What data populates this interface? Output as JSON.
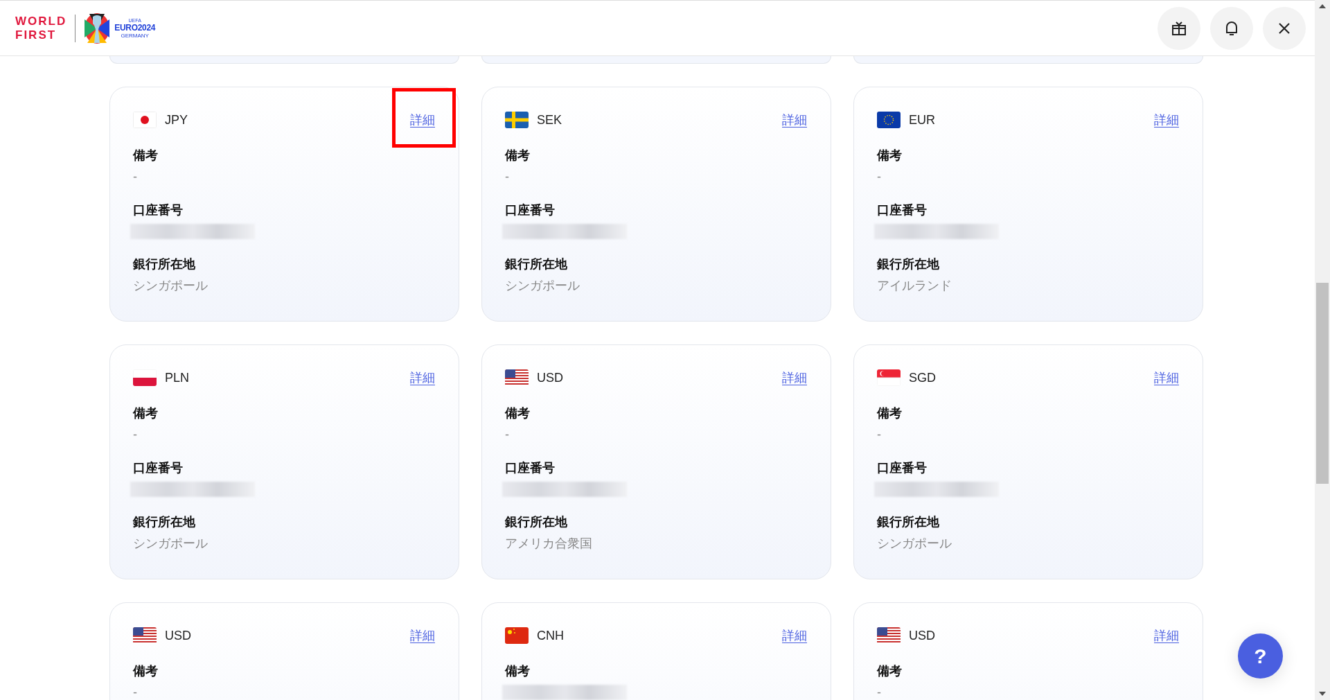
{
  "header": {
    "brand_lines": [
      "WORLD",
      "FIRST"
    ],
    "euro_logo": {
      "top": "UEFA",
      "main": "EURO2024",
      "sub": "GERMANY"
    }
  },
  "cards": [
    {
      "currency": "JPY",
      "kind": "jp",
      "link": "詳細",
      "highlighted": true,
      "fields": [
        {
          "label": "備考",
          "value": {
            "kind": "text",
            "text": "-"
          }
        },
        {
          "label": "口座番号",
          "value": {
            "kind": "blurred"
          }
        },
        {
          "label": "銀行所在地",
          "value": {
            "kind": "text",
            "text": "シンガポール"
          }
        }
      ]
    },
    {
      "currency": "SEK",
      "kind": "se",
      "link": "詳細",
      "highlighted": false,
      "fields": [
        {
          "label": "備考",
          "value": {
            "kind": "text",
            "text": "-"
          }
        },
        {
          "label": "口座番号",
          "value": {
            "kind": "blurred"
          }
        },
        {
          "label": "銀行所在地",
          "value": {
            "kind": "text",
            "text": "シンガポール"
          }
        }
      ]
    },
    {
      "currency": "EUR",
      "kind": "eu",
      "link": "詳細",
      "highlighted": false,
      "fields": [
        {
          "label": "備考",
          "value": {
            "kind": "text",
            "text": "-"
          }
        },
        {
          "label": "口座番号",
          "value": {
            "kind": "blurred"
          }
        },
        {
          "label": "銀行所在地",
          "value": {
            "kind": "text",
            "text": "アイルランド"
          }
        }
      ]
    },
    {
      "currency": "PLN",
      "kind": "pl",
      "link": "詳細",
      "highlighted": false,
      "fields": [
        {
          "label": "備考",
          "value": {
            "kind": "text",
            "text": "-"
          }
        },
        {
          "label": "口座番号",
          "value": {
            "kind": "blurred"
          }
        },
        {
          "label": "銀行所在地",
          "value": {
            "kind": "text",
            "text": "シンガポール"
          }
        }
      ]
    },
    {
      "currency": "USD",
      "kind": "us",
      "link": "詳細",
      "highlighted": false,
      "fields": [
        {
          "label": "備考",
          "value": {
            "kind": "text",
            "text": "-"
          }
        },
        {
          "label": "口座番号",
          "value": {
            "kind": "blurred"
          }
        },
        {
          "label": "銀行所在地",
          "value": {
            "kind": "text",
            "text": "アメリカ合衆国"
          }
        }
      ]
    },
    {
      "currency": "SGD",
      "kind": "sg",
      "link": "詳細",
      "highlighted": false,
      "fields": [
        {
          "label": "備考",
          "value": {
            "kind": "text",
            "text": "-"
          }
        },
        {
          "label": "口座番号",
          "value": {
            "kind": "blurred"
          }
        },
        {
          "label": "銀行所在地",
          "value": {
            "kind": "text",
            "text": "シンガポール"
          }
        }
      ]
    },
    {
      "currency": "USD",
      "kind": "us",
      "link": "詳細",
      "highlighted": false,
      "fields": [
        {
          "label": "備考",
          "value": {
            "kind": "text",
            "text": "-"
          }
        }
      ]
    },
    {
      "currency": "CNH",
      "kind": "cn",
      "link": "詳細",
      "highlighted": false,
      "fields": [
        {
          "label": "備考",
          "value": {
            "kind": "blurred"
          }
        }
      ]
    },
    {
      "currency": "USD",
      "kind": "us",
      "link": "詳細",
      "highlighted": false,
      "fields": [
        {
          "label": "備考",
          "value": {
            "kind": "text",
            "text": "-"
          }
        }
      ]
    }
  ],
  "help_button": {
    "label": "?"
  }
}
